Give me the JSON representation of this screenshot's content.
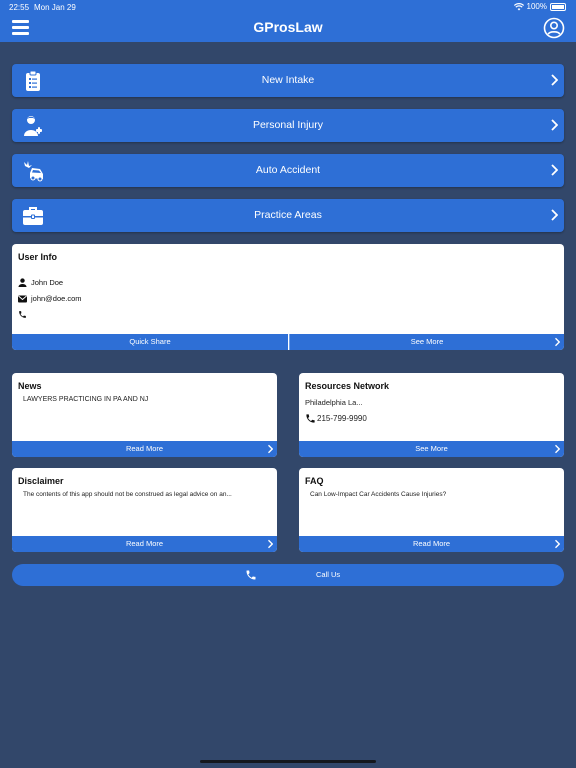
{
  "status_bar": {
    "time": "22:55",
    "date": "Mon Jan 29",
    "battery": "100%"
  },
  "header": {
    "title": "GProsLaw"
  },
  "menu": [
    {
      "label": "New Intake",
      "icon": "clipboard-icon"
    },
    {
      "label": "Personal Injury",
      "icon": "injured-person-icon"
    },
    {
      "label": "Auto Accident",
      "icon": "car-crash-icon"
    },
    {
      "label": "Practice Areas",
      "icon": "briefcase-icon"
    }
  ],
  "user_info": {
    "title": "User Info",
    "name": "John Doe",
    "email": "john@doe.com",
    "phone": "",
    "quick_share": "Quick Share",
    "see_more": "See More"
  },
  "news": {
    "title": "News",
    "text": "LAWYERS PRACTICING IN PA AND NJ",
    "action": "Read More"
  },
  "resources": {
    "title": "Resources Network",
    "text": "Philadelphia La...",
    "phone": "215-799-9990",
    "action": "See More"
  },
  "disclaimer": {
    "title": "Disclaimer",
    "text": "The contents of this app should not be construed as legal advice on an...",
    "action": "Read More"
  },
  "faq": {
    "title": "FAQ",
    "text": "Can Low-Impact Car Accidents Cause Injuries?",
    "action": "Read More"
  },
  "call": {
    "label": "Call Us"
  },
  "colors": {
    "background": "#32476a",
    "accent": "#2e6fd6",
    "card": "#ffffff"
  }
}
